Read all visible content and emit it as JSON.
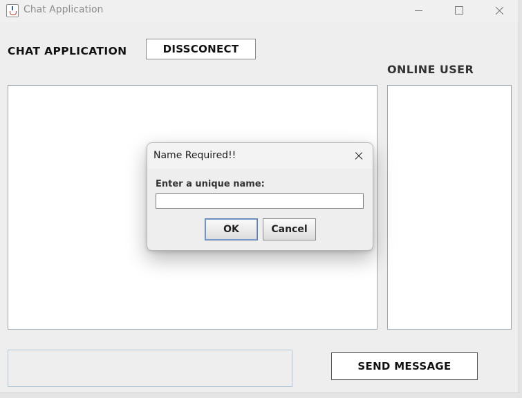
{
  "window": {
    "title": "Chat Application",
    "icon": "java-cup-icon"
  },
  "header": {
    "app_label": "CHAT APPLICATION",
    "disconnect_label": "DISSCONECT",
    "online_user_label": "ONLINE USER"
  },
  "footer": {
    "message_value": "",
    "send_label": "SEND MESSAGE"
  },
  "dialog": {
    "title": "Name Required!!",
    "prompt": "Enter a unique name:",
    "input_value": "",
    "ok_label": "OK",
    "cancel_label": "Cancel"
  },
  "colors": {
    "window_bg": "#eeeeee",
    "field_border": "#9aa6b0",
    "default_button_border": "#5a7fb5"
  }
}
